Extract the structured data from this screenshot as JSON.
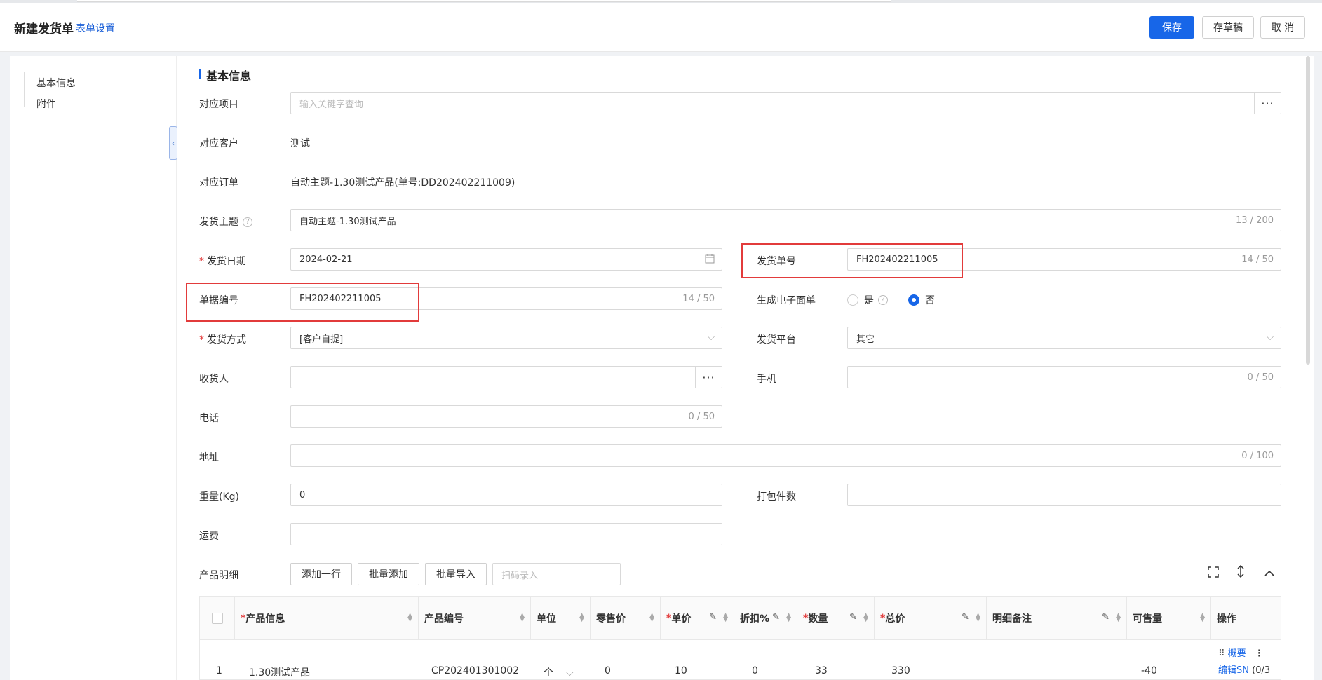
{
  "header": {
    "title": "新建发货单",
    "form_settings": "表单设置",
    "save": "保存",
    "draft": "存草稿",
    "cancel": "取 消"
  },
  "leftnav": {
    "items": [
      "基本信息",
      "附件"
    ]
  },
  "section": {
    "title": "基本信息"
  },
  "form": {
    "project": {
      "label": "对应项目",
      "placeholder": "输入关键字查询"
    },
    "customer": {
      "label": "对应客户",
      "value": "测试"
    },
    "order": {
      "label": "对应订单",
      "value": "自动主题-1.30测试产品(单号:DD202402211009)"
    },
    "subject": {
      "label": "发货主题",
      "value": "自动主题-1.30测试产品",
      "count": "13 / 200"
    },
    "ship_date": {
      "label": "发货日期",
      "value": "2024-02-21"
    },
    "ship_no": {
      "label": "发货单号",
      "value": "FH202402211005",
      "count": "14 / 50"
    },
    "doc_no": {
      "label": "单据编号",
      "value": "FH202402211005",
      "count": "14 / 50"
    },
    "e_waybill": {
      "label": "生成电子面单",
      "yes": "是",
      "no": "否",
      "selected": "否"
    },
    "ship_method": {
      "label": "发货方式",
      "value": "[客户自提]"
    },
    "ship_platform": {
      "label": "发货平台",
      "value": "其它"
    },
    "receiver": {
      "label": "收货人",
      "value": ""
    },
    "mobile": {
      "label": "手机",
      "count": "0 / 50"
    },
    "phone": {
      "label": "电话",
      "count": "0 / 50"
    },
    "address": {
      "label": "地址",
      "count": "0 / 100"
    },
    "weight": {
      "label": "重量(Kg)",
      "value": "0"
    },
    "packages": {
      "label": "打包件数",
      "value": ""
    },
    "freight": {
      "label": "运费",
      "value": ""
    }
  },
  "products": {
    "label": "产品明细",
    "add_row": "添加一行",
    "batch_add": "批量添加",
    "batch_import": "批量导入",
    "scan_placeholder": "扫码录入",
    "columns": [
      "产品信息",
      "产品编号",
      "单位",
      "零售价",
      "单价",
      "折扣%",
      "数量",
      "总价",
      "明细备注",
      "可售量",
      "操作"
    ],
    "rows": [
      {
        "index": "1",
        "name": "1.30测试产品",
        "code": "CP202401301002",
        "unit": "个",
        "retail": "0",
        "price": "10",
        "discount": "0",
        "qty": "33",
        "total": "330",
        "note": "",
        "sellable": "-40",
        "op_summary": "概要",
        "op_edit_sn": "编辑SN",
        "op_sn_count": "(0/3"
      }
    ]
  },
  "colors": {
    "primary": "#1766e8",
    "highlight": "#e23b3b"
  }
}
